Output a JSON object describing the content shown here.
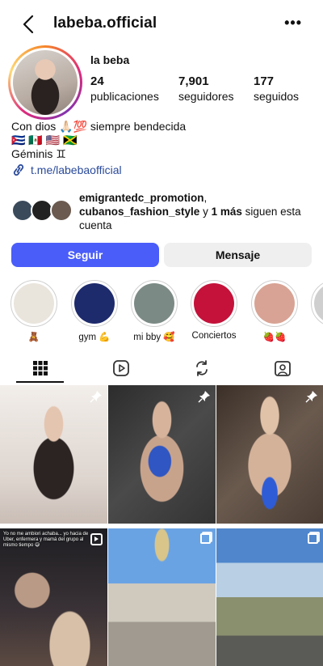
{
  "header": {
    "username": "labeba.official",
    "more_label": "•••"
  },
  "profile": {
    "display_name": "la beba",
    "stats": [
      {
        "value": "24",
        "label": "publicaciones"
      },
      {
        "value": "7,901",
        "label": "seguidores"
      },
      {
        "value": "177",
        "label": "seguidos"
      }
    ],
    "bio_lines": [
      "Con dios 🙏🏻💯 siempre bendecida",
      "🇨🇺 🇲🇽 🇺🇸 🇯🇲",
      "Géminis ♊"
    ],
    "link": "t.me/labebaofficial"
  },
  "followed_by": {
    "names": [
      "emigrantedc_promotion",
      "cubanos_fashion_style"
    ],
    "sep": ",",
    "and": " y ",
    "more": "1 más",
    "suffix": " siguen esta cuenta"
  },
  "actions": {
    "follow": "Seguir",
    "message": "Mensaje"
  },
  "highlights": [
    {
      "label": "🧸",
      "color": "#e9e4dc"
    },
    {
      "label": "gym 💪",
      "color": "#1d2a6b"
    },
    {
      "label": "mi bby 🥰",
      "color": "#7c8a86"
    },
    {
      "label": "Conciertos",
      "color": "#c4123a"
    },
    {
      "label": "🍓🍓",
      "color": "#d8a394"
    },
    {
      "label": "",
      "color": "#cfcfcf"
    }
  ],
  "tabs": [
    "grid-icon",
    "reels-icon",
    "reposts-icon",
    "tagged-icon"
  ],
  "posts": [
    {
      "type": "pinned",
      "colors": [
        "#efeae6",
        "#c9b7ad",
        "#2b2422"
      ]
    },
    {
      "type": "pinned",
      "colors": [
        "#3a3a3a",
        "#c8a38c",
        "#2f56c2"
      ]
    },
    {
      "type": "pinned",
      "colors": [
        "#4a3c34",
        "#d4b29a",
        "#2e5cd6"
      ]
    },
    {
      "type": "reel",
      "colors": [
        "#2a2a2e",
        "#b99a86",
        "#5c4a42"
      ],
      "caption": "Yo no me ambiori achaba... yo hacia de Uber, enfermera y mamá del grupo al mismo tiempo 😅"
    },
    {
      "type": "carousel",
      "colors": [
        "#7ab0e8",
        "#c4bfb6",
        "#5a5550"
      ]
    },
    {
      "type": "carousel",
      "colors": [
        "#5e8fd0",
        "#a9c0d8",
        "#6a7a4e"
      ]
    }
  ]
}
